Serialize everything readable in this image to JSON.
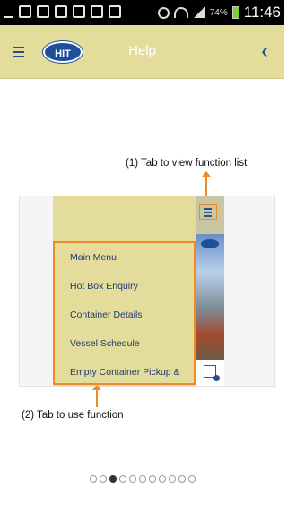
{
  "status_bar": {
    "time": "11:46",
    "battery_percent": "74%",
    "icons": [
      "usb-icon",
      "signal-strength-icon",
      "image-icon",
      "mail-icon",
      "mail-x-icon",
      "mail-icon",
      "chat-icon",
      "alarm-icon",
      "wifi-icon",
      "cell-signal-icon",
      "battery-icon"
    ]
  },
  "app_bar": {
    "title": "Help",
    "logo_text": "HIT",
    "menu_icon": "hamburger-icon",
    "back_icon": "chevron-left-icon",
    "background": "#e3dc9a",
    "accent": "#2a4f8a"
  },
  "help": {
    "caption_top": "(1) Tab to view function list",
    "caption_bottom": "(2) Tab to use function",
    "highlight_color": "#f08a24",
    "screenshot": {
      "menu_items": [
        "Main Menu",
        "Hot Box Enquiry",
        "Container Details",
        "Vessel Schedule",
        "Empty Container Pickup &"
      ]
    }
  },
  "pagination": {
    "total_pages": 11,
    "current_page": 3
  }
}
